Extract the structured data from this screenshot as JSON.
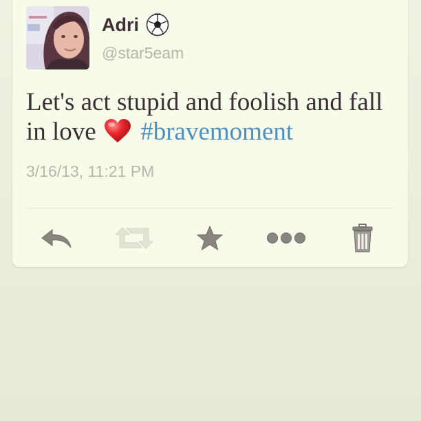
{
  "tweet": {
    "author_name": "Adri",
    "author_badge_icon": "soccer-ball-icon",
    "handle": "@star5eam",
    "text_main": "Let's act stupid and  foolish and fall in love ",
    "emoji_icon": "red-heart-icon",
    "hashtag": "#bravemoment",
    "timestamp": "3/16/13, 11:21 PM"
  },
  "actions": [
    {
      "name": "reply",
      "icon": "reply-arrow-icon"
    },
    {
      "name": "retweet",
      "icon": "retweet-icon"
    },
    {
      "name": "favorite",
      "icon": "star-icon"
    },
    {
      "name": "more",
      "icon": "more-dots-icon"
    },
    {
      "name": "delete",
      "icon": "trash-can-icon"
    }
  ],
  "colors": {
    "background": "#e9eedc",
    "card": "#f7fbea",
    "hashtag": "#4f8fbf",
    "text": "#3a3035",
    "muted": "#b5b8aa",
    "icon": "#8a8580"
  }
}
